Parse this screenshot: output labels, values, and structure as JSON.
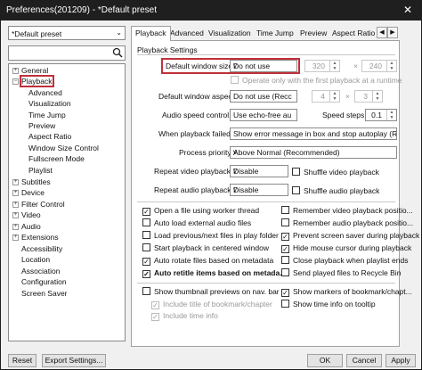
{
  "window": {
    "title": "Preferences(201209) - *Default preset",
    "close": "✕"
  },
  "left": {
    "preset": "*Default preset",
    "tree": [
      {
        "label": "General",
        "expander": "+"
      },
      {
        "label": "Playback",
        "expander": "−"
      },
      {
        "label": "Advanced"
      },
      {
        "label": "Visualization"
      },
      {
        "label": "Time Jump"
      },
      {
        "label": "Preview"
      },
      {
        "label": "Aspect Ratio"
      },
      {
        "label": "Window Size Control"
      },
      {
        "label": "Fullscreen Mode"
      },
      {
        "label": "Playlist"
      },
      {
        "label": "Subtitles",
        "expander": "+"
      },
      {
        "label": "Device",
        "expander": "+"
      },
      {
        "label": "Filter Control",
        "expander": "+"
      },
      {
        "label": "Video",
        "expander": "+"
      },
      {
        "label": "Audio",
        "expander": "+"
      },
      {
        "label": "Extensions",
        "expander": "+"
      },
      {
        "label": "Accessibility"
      },
      {
        "label": "Location"
      },
      {
        "label": "Association"
      },
      {
        "label": "Configuration"
      },
      {
        "label": "Screen Saver"
      }
    ]
  },
  "tabs": [
    "Playback",
    "Advanced",
    "Visualization",
    "Time Jump",
    "Preview",
    "Aspect Ratio",
    "Win"
  ],
  "tab_arrows": [
    "◀",
    "▶"
  ],
  "settings": {
    "group_title": "Playback Settings",
    "default_window_size": {
      "label": "Default window size:",
      "value": "Do not use",
      "w": "320",
      "x": "×",
      "h": "240"
    },
    "operate_first": "Operate only with the first playback at a runtime",
    "default_window_aspect": {
      "label": "Default window aspect",
      "value": "Do not use (Recc",
      "w": "4",
      "x": "×",
      "h": "3"
    },
    "audio_speed": {
      "label": "Audio speed control:",
      "value": "Use echo-free au",
      "steps_label": "Speed steps:",
      "steps_value": "0.1"
    },
    "playback_failed": {
      "label": "When playback failed:",
      "value": "Show error message in box and stop autoplay (Re"
    },
    "process_priority": {
      "label": "Process priority:",
      "value": "Above Normal (Recommended)"
    },
    "repeat_video": {
      "label": "Repeat video playback:",
      "value": "Disable",
      "shuffle": "Shuffle video playback"
    },
    "repeat_audio": {
      "label": "Repeat audio playback:",
      "value": "Disable",
      "shuffle": "Shuffle audio playback"
    }
  },
  "checks_left": [
    {
      "label": "Open a file using worker thread",
      "checked": true,
      "bold": false
    },
    {
      "label": "Auto load external audio files",
      "checked": false,
      "bold": false
    },
    {
      "label": "Load previous/next files in play folder",
      "checked": false,
      "bold": false
    },
    {
      "label": "Start playback in centered window",
      "checked": false,
      "bold": false
    },
    {
      "label": "Auto rotate files based on metadata",
      "checked": true,
      "bold": false
    },
    {
      "label": "Auto retitle items based on metada...",
      "checked": true,
      "bold": true
    }
  ],
  "checks_right": [
    {
      "label": "Remember video playback positio...",
      "checked": false
    },
    {
      "label": "Remember audio playback positio...",
      "checked": false
    },
    {
      "label": "Prevent screen saver during playback",
      "checked": true
    },
    {
      "label": "Hide mouse cursor during playback",
      "checked": true
    },
    {
      "label": "Close playback when playlist ends",
      "checked": false
    },
    {
      "label": "Send played files to Recycle Bin",
      "checked": false
    }
  ],
  "bottom_checks": {
    "thumbnail": "Show thumbnail previews on nav. bar",
    "include_title": "Include title of bookmark/chapter",
    "include_time": "Include time info",
    "markers": "Show markers of bookmark/chapt...",
    "time_tooltip": "Show time info on tooltip"
  },
  "buttons": {
    "reset": "Reset",
    "export": "Export Settings...",
    "ok": "OK",
    "cancel": "Cancel",
    "apply": "Apply"
  },
  "colors": {
    "highlight": "#c0303a",
    "titlebar": "#1f1f1f"
  },
  "icons": {
    "search": "search-icon",
    "dropdown": "chevron-down-icon",
    "check": "✓"
  }
}
